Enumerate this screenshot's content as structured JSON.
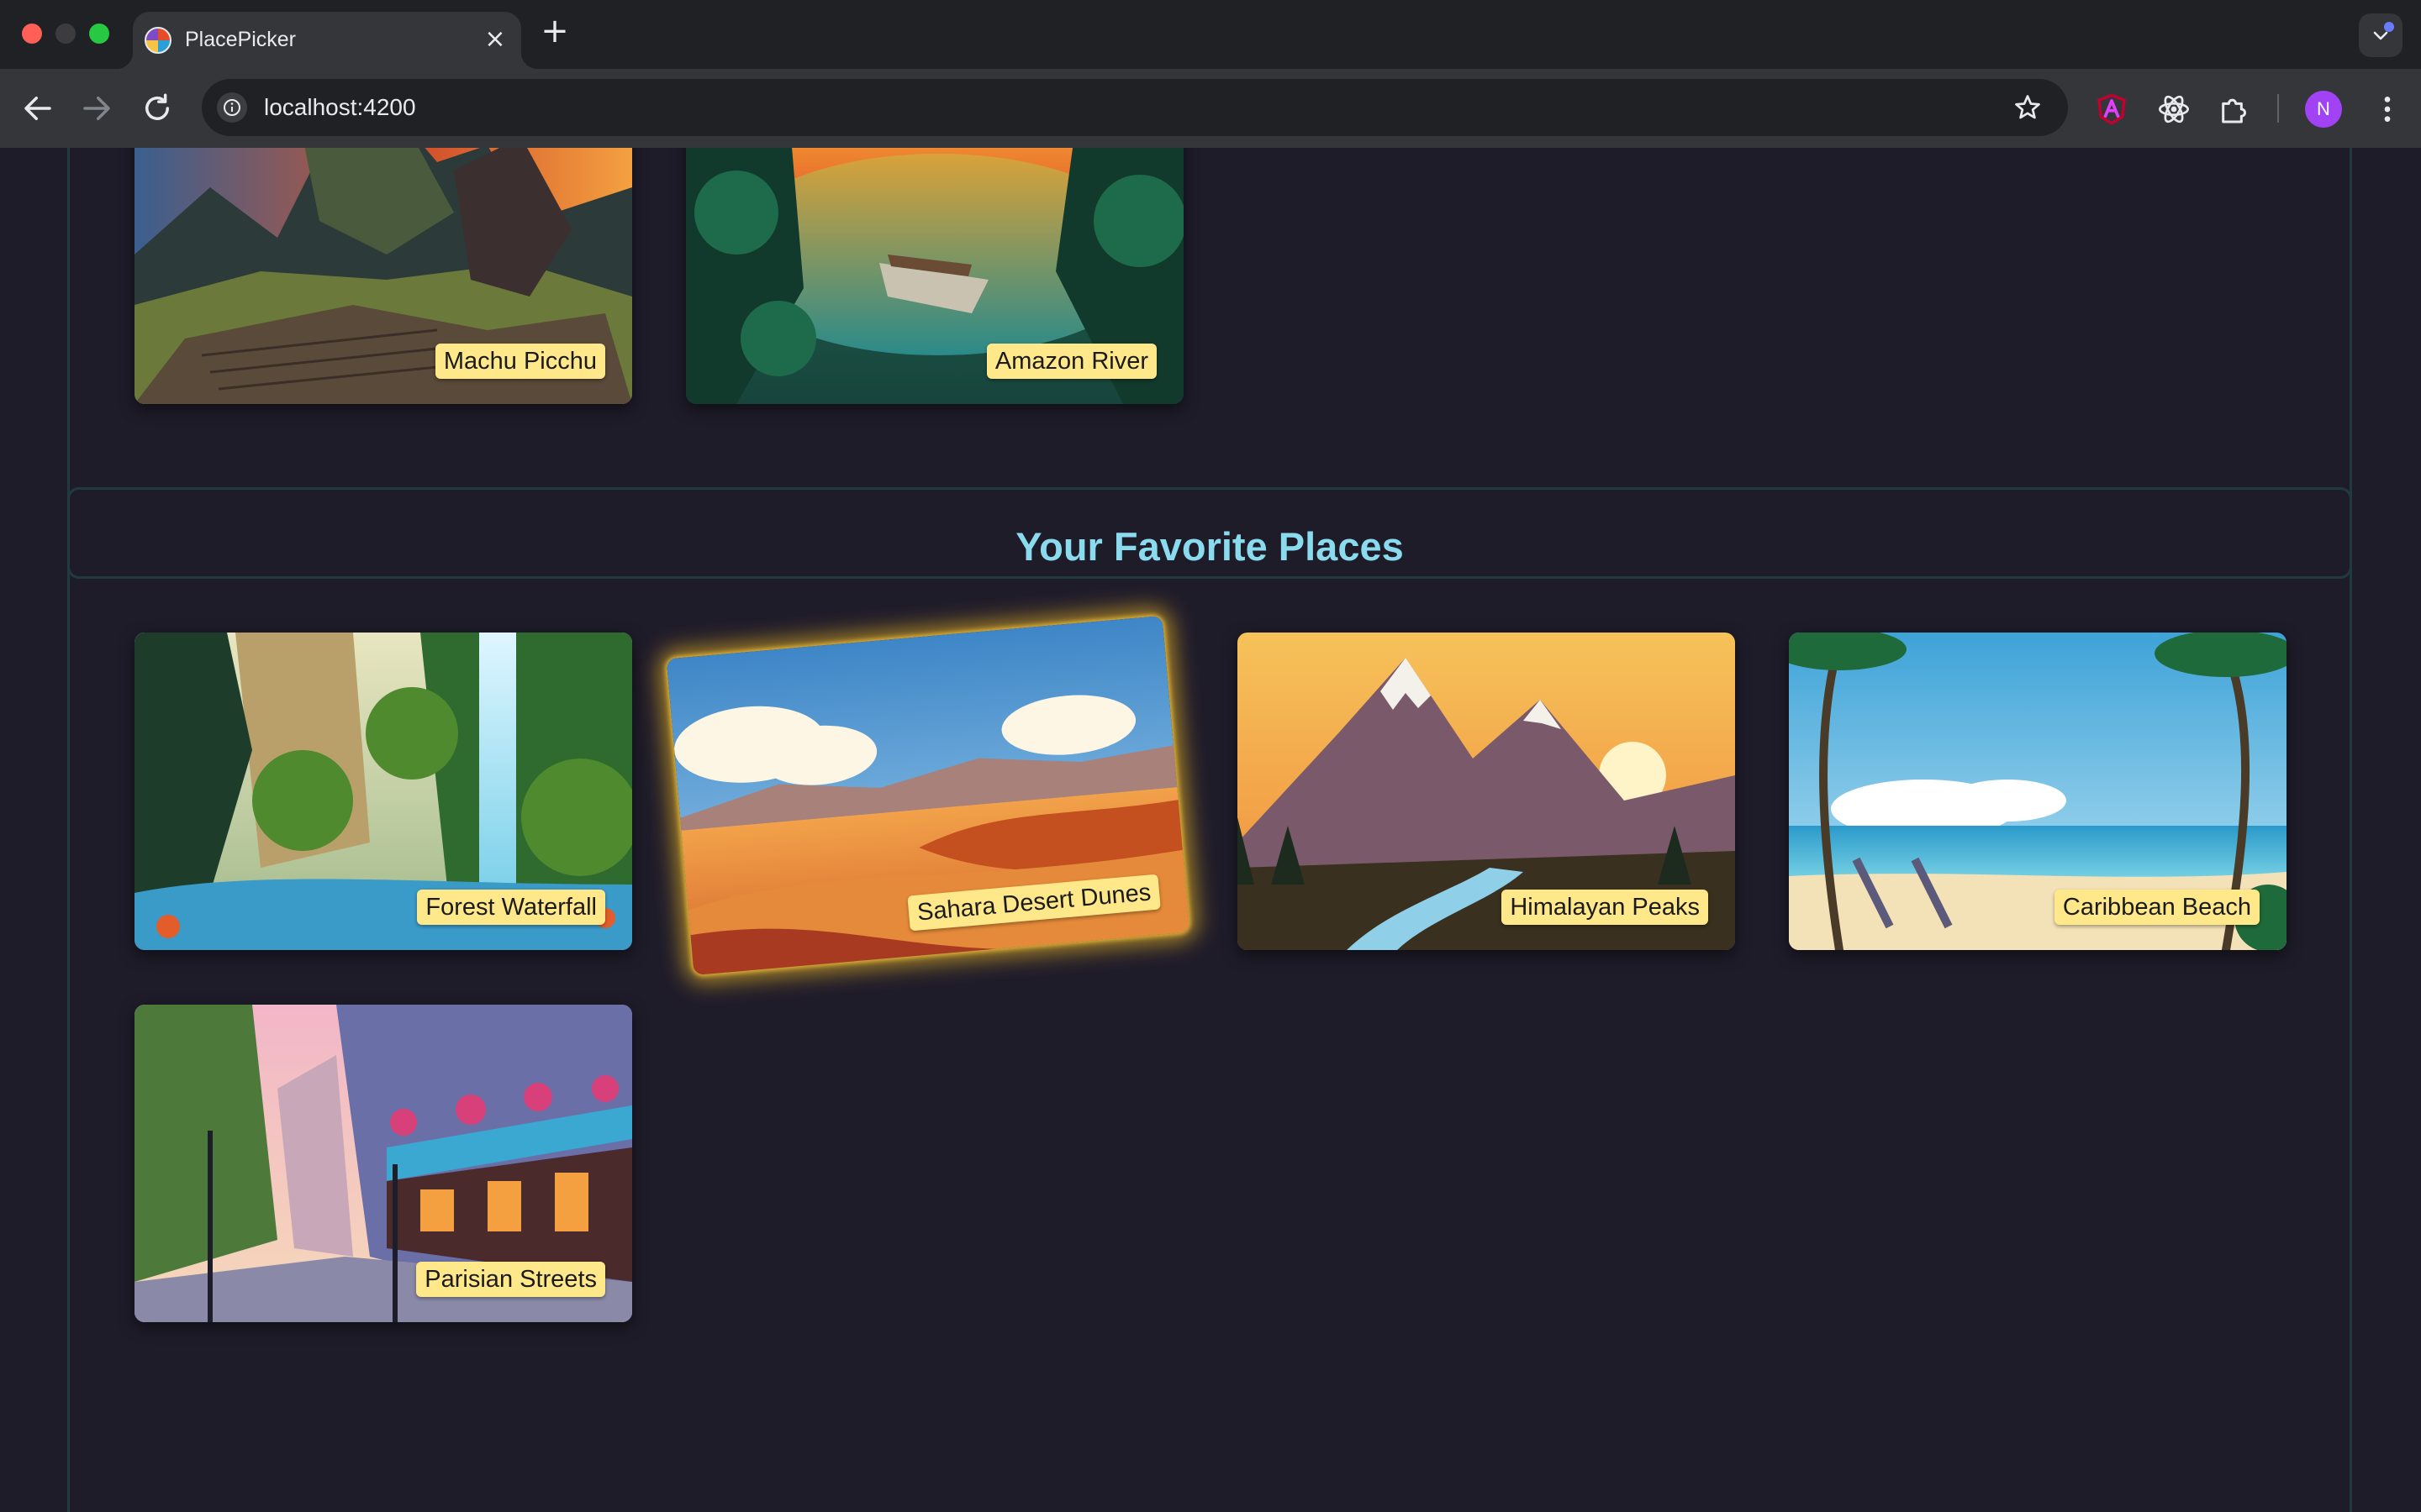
{
  "browser": {
    "tab_title": "PlacePicker",
    "tab_close": "×",
    "new_tab": "+",
    "url": "localhost:4200",
    "profile_initial": "N"
  },
  "available_places": [
    {
      "title": "Machu Picchu"
    },
    {
      "title": "Amazon River"
    }
  ],
  "favorites": {
    "heading": "Your Favorite Places",
    "places": [
      {
        "title": "Forest Waterfall",
        "selected": false
      },
      {
        "title": "Sahara Desert Dunes",
        "selected": true
      },
      {
        "title": "Himalayan Peaks",
        "selected": false
      },
      {
        "title": "Caribbean Beach",
        "selected": false
      },
      {
        "title": "Parisian Streets",
        "selected": false
      }
    ]
  },
  "colors": {
    "page_background": "#1f1c2a",
    "section_border": "#213a40",
    "heading": "#8bdbef",
    "label_background": "#ffe88a",
    "selected_glow": "#dbaa28"
  }
}
